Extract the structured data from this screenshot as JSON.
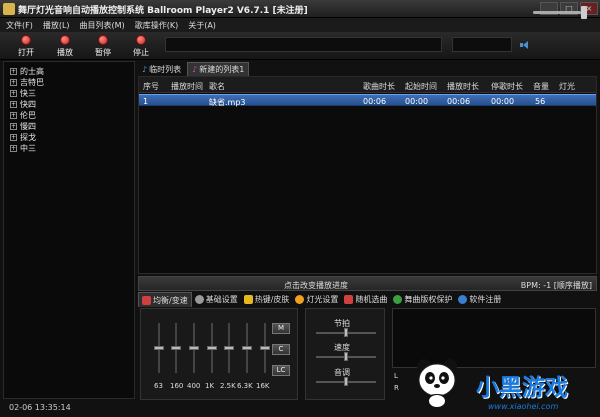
{
  "window": {
    "title": "舞厅灯光音响自动播放控制系统 Ballroom Player2 V6.7.1 [未注册]"
  },
  "menu": [
    "文件(F)",
    "播放(L)",
    "曲目列表(M)",
    "歌库操作(K)",
    "关于(A)"
  ],
  "toolbar": {
    "open": "打开",
    "play": "播放",
    "pause": "暂停",
    "stop": "停止",
    "volume_fraction": 0.92
  },
  "categories": [
    "的士高",
    "吉特巴",
    "快三",
    "快四",
    "伦巴",
    "慢四",
    "探戈",
    "中三"
  ],
  "playlist_tabs": [
    "临时列表",
    "新建的列表1"
  ],
  "columns": [
    "序号",
    "播放时间",
    "歌名",
    "歌曲时长",
    "起始时间",
    "播放时长",
    "停歌时长",
    "音量",
    "灯光"
  ],
  "rows": [
    {
      "index": "1",
      "play_time": "",
      "name": "缺省.mp3",
      "duration": "00:06",
      "start": "00:00",
      "play_len": "00:06",
      "stop_len": "00:00",
      "volume": "56",
      "light": ""
    }
  ],
  "seek": {
    "text": "点击改变播放进度",
    "bpm": "BPM: -1",
    "mode": "[顺序播放]"
  },
  "bottom_tabs": [
    "均衡/变速",
    "基础设置",
    "热键/皮肤",
    "灯光设置",
    "随机选曲",
    "舞曲版权保护",
    "软件注册"
  ],
  "equalizer": {
    "bands": [
      "63",
      "160",
      "400",
      "1K",
      "2.5K",
      "6.3K",
      "16K"
    ],
    "levels": [
      0.5,
      0.5,
      0.5,
      0.5,
      0.5,
      0.5,
      0.5
    ],
    "buttons": [
      "M",
      "C",
      "LC"
    ]
  },
  "rhythm": {
    "beat": "节拍",
    "speed": "速度",
    "pitch": "音调"
  },
  "channels": [
    "L",
    "R"
  ],
  "status": "02-06 13:35:14",
  "watermark": {
    "text": "小黑游戏",
    "url": "www.xiaohei.com"
  },
  "colors": {
    "selection": "#3e6fb8",
    "accent": "#1a7be0"
  }
}
